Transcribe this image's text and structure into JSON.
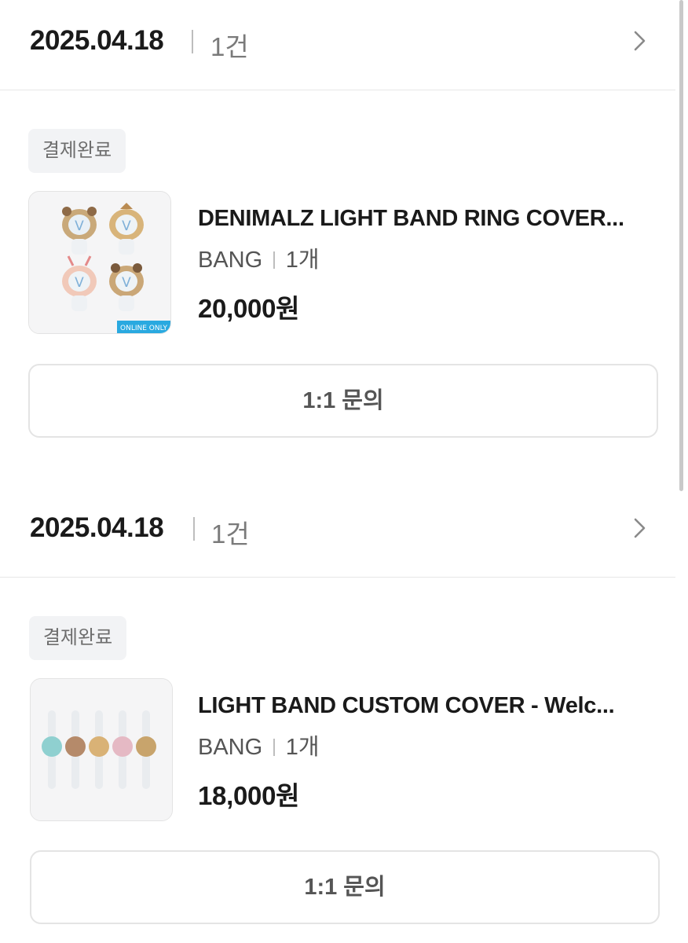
{
  "orders": [
    {
      "date": "2025.04.18",
      "count": "1건",
      "status": "결제완료",
      "product": {
        "name": "DENIMALZ LIGHT BAND RING COVER...",
        "seller": "BANG",
        "quantity": "1개",
        "price": "20,000원",
        "thumb_label": "ONLINE ONLY"
      },
      "inquiry_label": "1:1 문의"
    },
    {
      "date": "2025.04.18",
      "count": "1건",
      "status": "결제완료",
      "product": {
        "name": "LIGHT BAND CUSTOM COVER - Welc...",
        "seller": "BANG",
        "quantity": "1개",
        "price": "18,000원"
      },
      "inquiry_label": "1:1 문의"
    }
  ]
}
